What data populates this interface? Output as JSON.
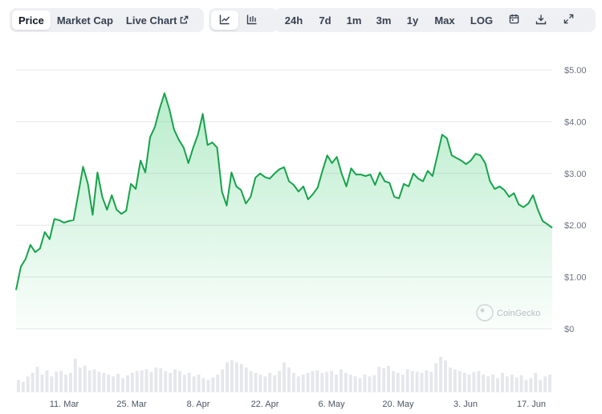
{
  "toolbar": {
    "tabs": [
      {
        "label": "Price",
        "active": true
      },
      {
        "label": "Market Cap",
        "active": false
      },
      {
        "label": "Live Chart",
        "active": false
      }
    ],
    "chart_types": [
      {
        "icon": "line-chart-icon",
        "active": true
      },
      {
        "icon": "candlestick-chart-icon",
        "active": false
      }
    ],
    "ranges": [
      "24h",
      "7d",
      "1m",
      "3m",
      "1y",
      "Max"
    ],
    "log_label": "LOG",
    "tools": [
      "calendar-icon",
      "download-icon",
      "expand-icon"
    ]
  },
  "watermark": "CoinGecko",
  "colors": {
    "line": "#16a34a",
    "fill_top": "#22c55e",
    "volume": "#e5e7eb",
    "grid": "#e5e7eb"
  },
  "chart_data": {
    "type": "area",
    "x_tick_labels": [
      "11. Mar",
      "25. Mar",
      "8. Apr",
      "22. Apr",
      "6. May",
      "20. May",
      "3. Jun",
      "17. Jun"
    ],
    "y_tick_labels": [
      "$0",
      "$1.00",
      "$2.00",
      "$3.00",
      "$4.00",
      "$5.00"
    ],
    "ylim": [
      0,
      5
    ],
    "grid": true,
    "series": [
      {
        "values": [
          0.75,
          1.2,
          1.35,
          1.62,
          1.48,
          1.55,
          1.87,
          1.73,
          2.12,
          2.1,
          2.05,
          2.08,
          2.1,
          2.6,
          3.13,
          2.8,
          2.2,
          3.02,
          2.55,
          2.3,
          2.58,
          2.3,
          2.22,
          2.28,
          2.8,
          2.7,
          3.25,
          3.02,
          3.7,
          3.9,
          4.25,
          4.55,
          4.25,
          3.85,
          3.65,
          3.5,
          3.2,
          3.5,
          3.75,
          4.15,
          3.55,
          3.6,
          3.5,
          2.65,
          2.38,
          3.02,
          2.75,
          2.68,
          2.42,
          2.55,
          2.92,
          3.0,
          2.93,
          2.9,
          3.0,
          3.08,
          3.12,
          2.85,
          2.78,
          2.65,
          2.75,
          2.5,
          2.6,
          2.73,
          3.05,
          3.35,
          3.2,
          3.32,
          3.0,
          2.75,
          3.1,
          2.98,
          2.98,
          2.95,
          2.98,
          2.78,
          3.02,
          2.85,
          2.82,
          2.55,
          2.52,
          2.8,
          2.75,
          3.0,
          2.9,
          2.85,
          3.05,
          2.95,
          3.35,
          3.75,
          3.68,
          3.35,
          3.3,
          3.25,
          3.18,
          3.25,
          3.38,
          3.35,
          3.2,
          2.85,
          2.7,
          2.75,
          2.68,
          2.55,
          2.62,
          2.4,
          2.35,
          2.42,
          2.58,
          2.3,
          2.08,
          2.02,
          1.95
        ]
      }
    ],
    "volume": [
      0.35,
      0.3,
      0.45,
      0.55,
      0.72,
      0.5,
      0.62,
      0.45,
      0.58,
      0.6,
      0.5,
      0.55,
      0.95,
      0.7,
      0.75,
      0.62,
      0.65,
      0.58,
      0.55,
      0.5,
      0.45,
      0.52,
      0.4,
      0.48,
      0.55,
      0.6,
      0.62,
      0.65,
      0.58,
      0.7,
      0.68,
      0.6,
      0.55,
      0.65,
      0.6,
      0.5,
      0.55,
      0.45,
      0.5,
      0.4,
      0.35,
      0.42,
      0.5,
      0.65,
      0.85,
      0.9,
      0.85,
      0.8,
      0.7,
      0.6,
      0.55,
      0.5,
      0.45,
      0.55,
      0.48,
      0.6,
      0.85,
      0.7,
      0.55,
      0.45,
      0.5,
      0.55,
      0.6,
      0.62,
      0.55,
      0.58,
      0.6,
      0.5,
      0.65,
      0.55,
      0.5,
      0.45,
      0.4,
      0.5,
      0.45,
      0.48,
      0.72,
      0.68,
      0.75,
      0.6,
      0.55,
      0.5,
      0.65,
      0.6,
      0.58,
      0.55,
      0.62,
      0.58,
      0.82,
      1.0,
      0.9,
      0.7,
      0.65,
      0.6,
      0.55,
      0.5,
      0.58,
      0.6,
      0.5,
      0.45,
      0.5,
      0.4,
      0.55,
      0.45,
      0.5,
      0.42,
      0.48,
      0.35,
      0.4,
      0.55,
      0.35,
      0.45,
      0.5
    ]
  }
}
